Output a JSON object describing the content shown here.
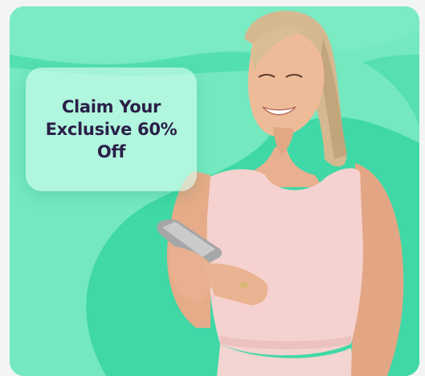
{
  "promo": {
    "headline": "Claim Your Exclusive 60% Off"
  },
  "colors": {
    "background": "#74e8bf",
    "blob": "#3fd8a6",
    "promo_box": "#d6fff0",
    "headline_text": "#2a1f48"
  },
  "icons": {
    "photo": "woman-smiling-with-smartphone-photo"
  }
}
